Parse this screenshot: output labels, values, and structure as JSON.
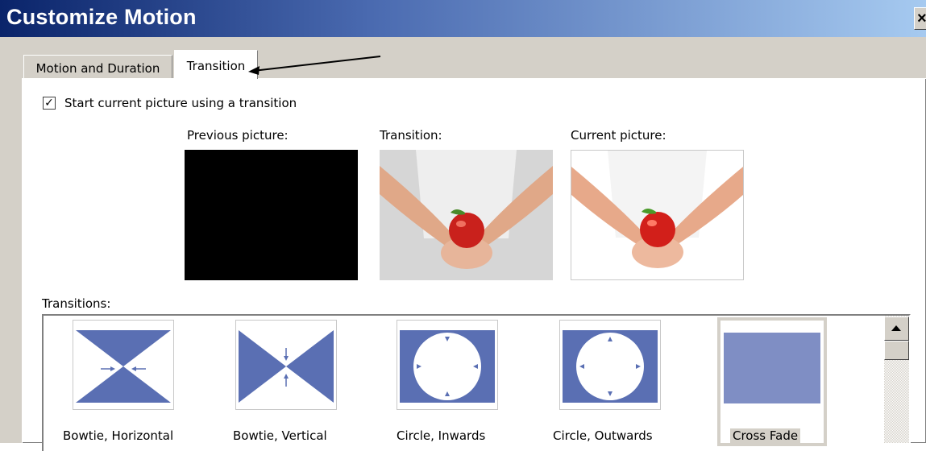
{
  "window": {
    "title": "Customize Motion",
    "close_label": "×"
  },
  "tabs": [
    {
      "label": "Motion and Duration",
      "active": false
    },
    {
      "label": "Transition",
      "active": true
    }
  ],
  "transition_tab": {
    "checkbox_label": "Start current picture using a transition",
    "checkbox_checked": true,
    "checkbox_mark": "✓",
    "previous_label": "Previous picture:",
    "transition_label": "Transition:",
    "current_label": "Current picture:",
    "transitions_label": "Transitions:",
    "items": [
      {
        "label": "Bowtie, Horizontal",
        "selected": false
      },
      {
        "label": "Bowtie, Vertical",
        "selected": false
      },
      {
        "label": "Circle, Inwards",
        "selected": false
      },
      {
        "label": "Circle, Outwards",
        "selected": false
      },
      {
        "label": "Cross Fade",
        "selected": true
      }
    ]
  },
  "colors": {
    "transition_blue": "#5a6fb3",
    "crossfade": "#7f8ec4",
    "titlebar": "#0a246a"
  }
}
